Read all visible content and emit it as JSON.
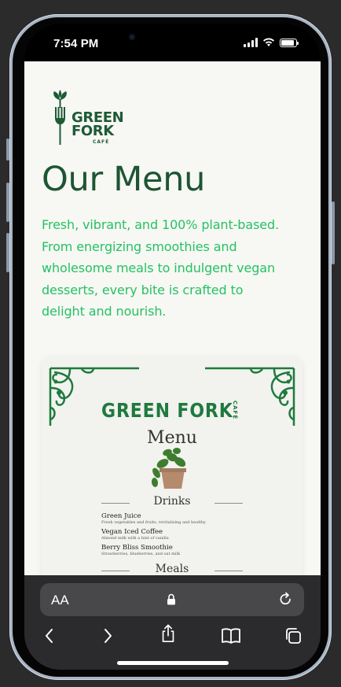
{
  "status_bar": {
    "time": "7:54 PM"
  },
  "logo": {
    "line1": "GREEN",
    "line2": "FORK",
    "line3": "CAFÉ"
  },
  "page": {
    "title": "Our Menu",
    "description": "Fresh, vibrant, and 100% plant-based. From energizing smoothies and wholesome meals to indulgent vegan desserts, every bite is crafted to delight and nourish."
  },
  "menu_card": {
    "brand": "GREEN FORK",
    "brand_sub": "CAFÉ",
    "heading": "Menu",
    "sections": [
      {
        "title": "Drinks",
        "items": [
          {
            "name": "Green Juice",
            "description": "Fresh vegetables and fruits, revitalizing and healthy"
          },
          {
            "name": "Vegan Iced Coffee",
            "description": "Almond milk with a hint of vanilla"
          },
          {
            "name": "Berry Bliss Smoothie",
            "description": "Strawberries, blueberries, and oat milk"
          }
        ]
      },
      {
        "title": "Meals",
        "items": []
      }
    ]
  },
  "browser": {
    "text_size_label": "AA",
    "icons": [
      "lock-icon",
      "reload-icon",
      "back-icon",
      "forward-icon",
      "share-icon",
      "bookmarks-icon",
      "tabs-icon"
    ]
  },
  "colors": {
    "title_green": "#1d5532",
    "description_green": "#25c262",
    "page_background": "#f7f7f4",
    "toolbar_background": "#2b2b2d"
  }
}
